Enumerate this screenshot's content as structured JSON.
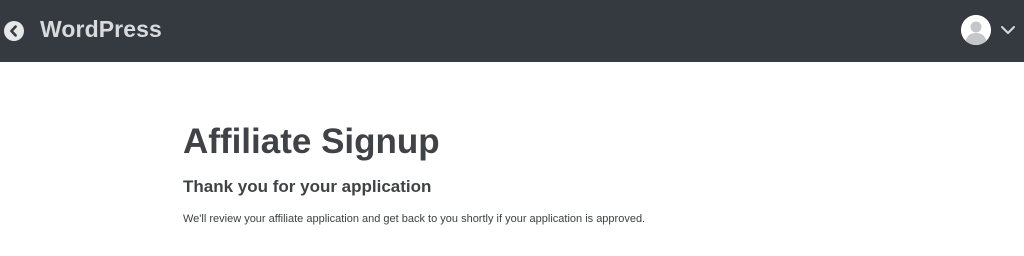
{
  "header": {
    "brand": "WordPress",
    "back_icon": "chevron-left-circle-icon",
    "user_icon": "user-avatar-icon",
    "menu_icon": "chevron-down-icon"
  },
  "main": {
    "title": "Affiliate Signup",
    "subtitle": "Thank you for your application",
    "message": "We'll review your affiliate application and get back to you shortly if your application is approved."
  },
  "colors": {
    "header_bg": "#353a40",
    "text": "#3f4246",
    "background": "#ffffff"
  }
}
